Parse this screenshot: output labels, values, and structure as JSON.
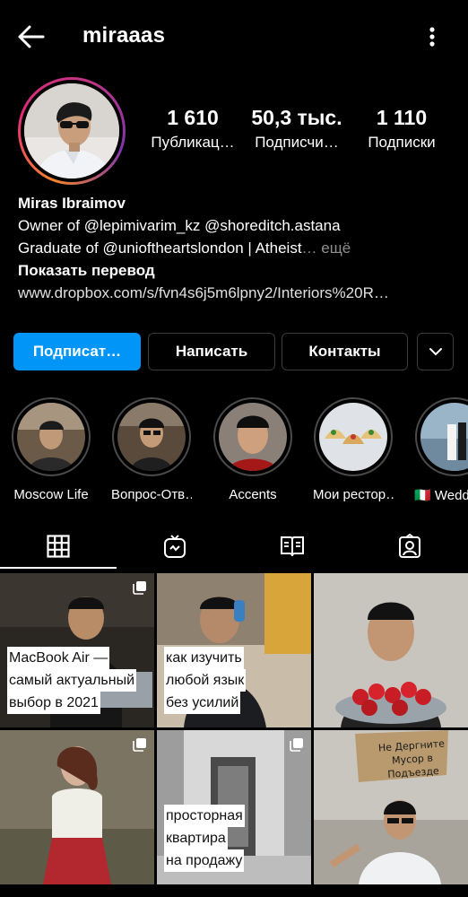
{
  "header": {
    "username": "miraaas"
  },
  "stats": [
    {
      "value": "1 610",
      "label": "Публикац…"
    },
    {
      "value": "50,3 тыс.",
      "label": "Подписчи…"
    },
    {
      "value": "1 110",
      "label": "Подписки"
    }
  ],
  "bio": {
    "name": "Miras Ibraimov",
    "line1": "Owner of @lepimivarim_kz @shoreditch.astana",
    "line2": "Graduate of @unioftheartslondon | Atheist",
    "more": "… ещё",
    "translate": "Показать перевод",
    "link": "www.dropbox.com/s/fvn4s6j5m6lpny2/Interiors%20R…"
  },
  "actions": {
    "follow": "Подписат…",
    "message": "Написать",
    "contacts": "Контакты"
  },
  "highlights": [
    {
      "label": "Moscow Life"
    },
    {
      "label": "Вопрос-Отв…"
    },
    {
      "label": "Accents"
    },
    {
      "label": "Мои рестор…"
    },
    {
      "label": "🇮🇹 Wedd"
    }
  ],
  "tabs": [
    "grid-icon",
    "igtv-icon",
    "guides-icon",
    "tagged-icon"
  ],
  "posts": [
    {
      "caption": [
        "MacBook Air —",
        "самый актуальный",
        "выбор в 2021"
      ]
    },
    {
      "caption": [
        "как изучить",
        "любой язык",
        "без усилий"
      ]
    },
    {
      "caption": []
    },
    {
      "caption": []
    },
    {
      "caption": [
        "просторная",
        "квартира",
        "на продажу"
      ]
    },
    {
      "caption": [],
      "sign": [
        "Не Дергните",
        "Мусор в Подъезде"
      ]
    }
  ],
  "colors": {
    "accent": "#0095f6",
    "background": "#000000"
  }
}
